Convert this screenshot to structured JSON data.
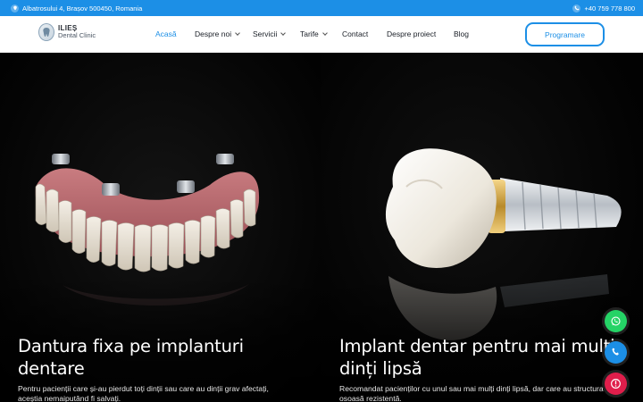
{
  "topbar": {
    "address": "Albatrosului 4, Brașov 500450, Romania",
    "phone": "+40 759 778 800"
  },
  "brand": {
    "name": "ILIEȘ",
    "subtitle": "Dental Clinic"
  },
  "nav": {
    "items": [
      {
        "label": "Acasă",
        "active": true,
        "dropdown": false
      },
      {
        "label": "Despre noi",
        "active": false,
        "dropdown": true
      },
      {
        "label": "Servicii",
        "active": false,
        "dropdown": true
      },
      {
        "label": "Tarife",
        "active": false,
        "dropdown": true
      },
      {
        "label": "Contact",
        "active": false,
        "dropdown": false
      },
      {
        "label": "Despre proiect",
        "active": false,
        "dropdown": false
      },
      {
        "label": "Blog",
        "active": false,
        "dropdown": false
      }
    ],
    "cta_label": "Programare"
  },
  "hero": {
    "panels": [
      {
        "title": "Dantura fixa pe implanturi dentare",
        "text_line1": "Pentru pacienții care și-au pierdut toți dinții sau care au dinții grav afectați,",
        "text_line2": "aceștia nemaiputând fi salvați."
      },
      {
        "title": "Implant dentar pentru mai mulți dinți lipsă",
        "text_line1": "Recomandat pacienților cu unul sau mai mulți dinți lipsă, dar care au structura",
        "text_line2": "osoasă rezistentă."
      }
    ]
  },
  "floating_actions": {
    "icons": [
      "whatsapp-icon",
      "phone-icon",
      "alert-icon"
    ]
  },
  "colors": {
    "accent": "#1c8fe6",
    "whatsapp": "#25d366",
    "alert": "#e01e4b"
  }
}
